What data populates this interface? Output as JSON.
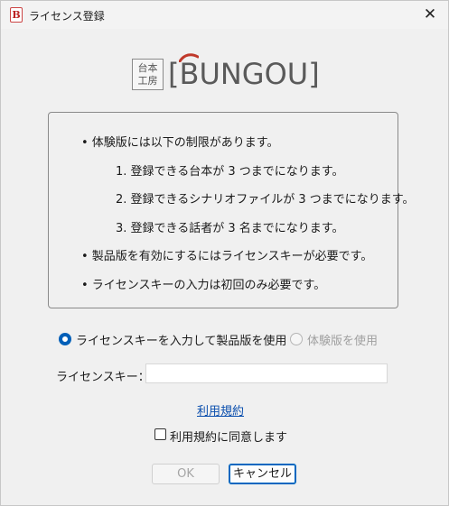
{
  "window": {
    "title": "ライセンス登録",
    "close_glyph": "✕",
    "app_icon_glyph": "B"
  },
  "logo": {
    "box_line1": "台本",
    "box_line2": "工房",
    "wordmark": "[BUNGOU]",
    "accent_color": "#c0392b"
  },
  "info": {
    "bullet1": "• 体験版には以下の制限があります。",
    "limits": [
      "1. 登録できる台本が 3 つまでになります。",
      "2. 登録できるシナリオファイルが 3 つまでになります。",
      "3. 登録できる話者が 3 名までになります。"
    ],
    "bullet2": "• 製品版を有効にするにはライセンスキーが必要です。",
    "bullet3": "• ライセンスキーの入力は初回のみ必要です。"
  },
  "mode": {
    "product_label": "ライセンスキーを入力して製品版を使用",
    "trial_label": "体験版を使用",
    "selected": "product"
  },
  "license": {
    "label": "ライセンスキー：",
    "value": ""
  },
  "terms": {
    "link_label": "利用規約",
    "agree_label": "利用規約に同意します",
    "agreed": false
  },
  "buttons": {
    "ok_label": "OK",
    "cancel_label": "キャンセル"
  },
  "colors": {
    "accent": "#005fb8",
    "link": "#0b4fae"
  }
}
